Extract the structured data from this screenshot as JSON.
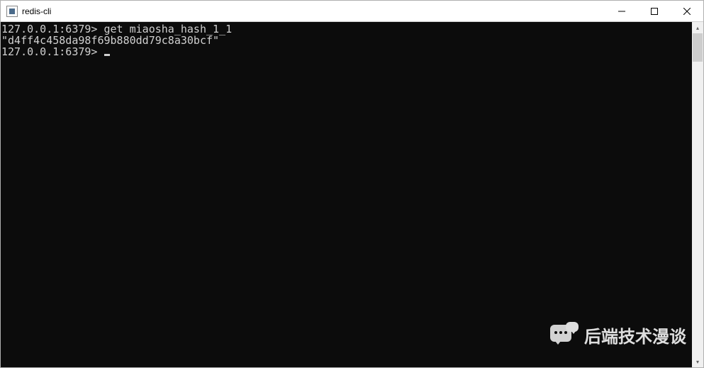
{
  "window": {
    "title": "redis-cli"
  },
  "terminal": {
    "lines": [
      {
        "prompt": "127.0.0.1:6379>",
        "command": "get miaosha_hash_1_1"
      },
      {
        "output": "\"d4ff4c458da98f69b880dd79c8a30bcf\""
      },
      {
        "prompt": "127.0.0.1:6379>",
        "command": "",
        "cursor": true
      }
    ]
  },
  "watermark": {
    "text": "后端技术漫谈"
  }
}
